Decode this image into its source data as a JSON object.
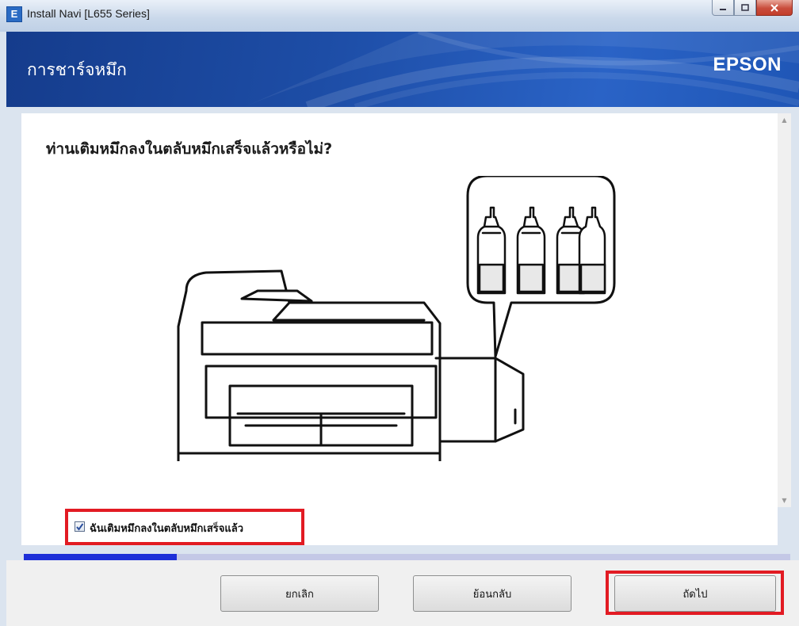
{
  "window": {
    "title": "Install Navi [L655 Series]",
    "app_icon_letter": "E",
    "controls": {
      "minimize": "minimize-icon",
      "maximize": "maximize-icon",
      "close": "close-icon"
    }
  },
  "header": {
    "title": "การชาร์จหมึก",
    "brand": "EPSON"
  },
  "main": {
    "question": "ท่านเติมหมึกลงในตลับหมึกเสร็จแล้วหรือไม่?",
    "illustration": "printer-with-ink-bottles"
  },
  "confirm": {
    "label": "ฉันเติมหมึกลงในตลับหมึกเสร็จแล้ว",
    "checked": true
  },
  "progress": {
    "value": 0.2
  },
  "buttons": {
    "cancel": "ยกเลิก",
    "back": "ย้อนกลับ",
    "next": "ถัดไป"
  },
  "colors": {
    "header_blue": "#1d4da6",
    "highlight_red": "#e21b23",
    "progress_fill": "#1d2fd8",
    "progress_track": "#c4c8e6"
  }
}
